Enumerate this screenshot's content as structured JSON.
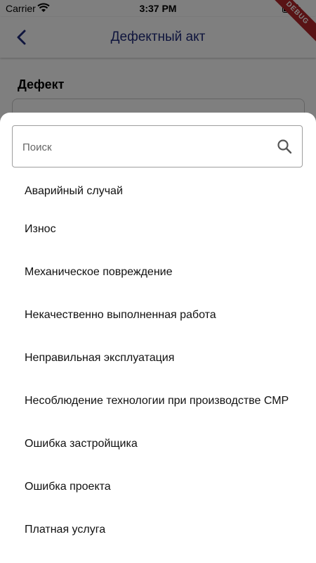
{
  "status_bar": {
    "carrier": "Carrier",
    "time": "3:37 PM",
    "wifi_icon": "wifi-icon",
    "battery_icon": "battery-icon"
  },
  "app_bar": {
    "title": "Дефектный акт",
    "back_icon": "chevron-left-icon",
    "debug_banner": "DEBUG"
  },
  "form": {
    "section_label": "Дефект"
  },
  "sheet": {
    "search": {
      "placeholder": "Поиск",
      "value": "",
      "icon": "search-icon"
    },
    "options": [
      "Аварийный случай",
      "Износ",
      "Механическое повреждение",
      "Некачественно выполненная работа",
      "Неправильная эксплуатация",
      "Несоблюдение технологии при производстве СМР",
      "Ошибка застройщика",
      "Ошибка проекта",
      "Платная услуга"
    ]
  },
  "colors": {
    "title_color": "#1f2a7a",
    "debug_color": "#b3262b"
  }
}
